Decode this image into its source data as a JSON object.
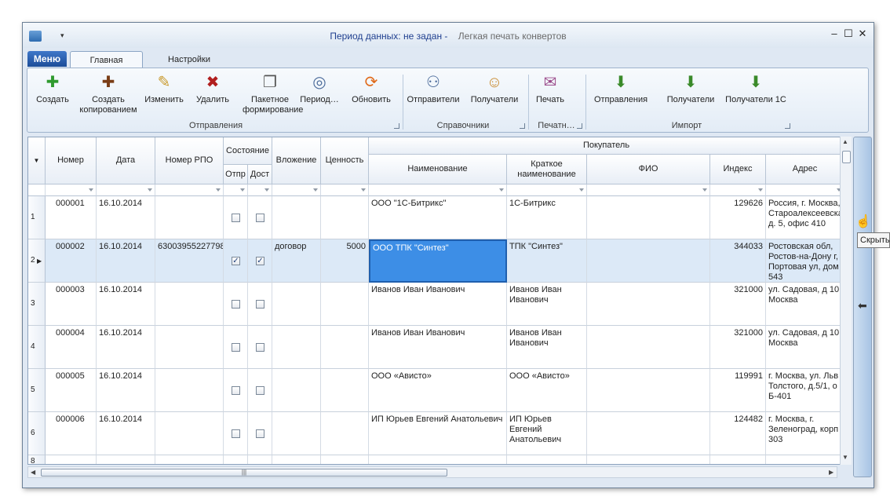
{
  "window": {
    "title_period": "Период данных: не задан -",
    "title_app": "Легкая печать конвертов",
    "minimize": "–",
    "maximize": "☐",
    "close": "✕",
    "qat_arrow": "▾"
  },
  "menu_button": "Меню",
  "tabs": [
    "Главная",
    "Настройки"
  ],
  "ribbon": {
    "groups": [
      {
        "label": "Отправления"
      },
      {
        "label": "Справочники"
      },
      {
        "label": "Печатн…"
      },
      {
        "label": "Импорт"
      }
    ],
    "buttons": [
      {
        "label": "Создать",
        "icon": "plus-green-icon",
        "glyph": "✚",
        "color": "#2f9a2f"
      },
      {
        "label": "Создать копированием",
        "icon": "plus-brown-icon",
        "glyph": "✚",
        "color": "#7a3d16"
      },
      {
        "label": "Изменить",
        "icon": "pencil-icon",
        "glyph": "✎",
        "color": "#c99a2e"
      },
      {
        "label": "Удалить",
        "icon": "delete-x-icon",
        "glyph": "✖",
        "color": "#b11f1f"
      },
      {
        "label": "Пакетное формирование",
        "icon": "pages-icon",
        "glyph": "❐",
        "color": "#555555"
      },
      {
        "label": "Период…",
        "icon": "calendar-globe-icon",
        "glyph": "◎",
        "color": "#4a6a9a"
      },
      {
        "label": "Обновить",
        "icon": "refresh-icon",
        "glyph": "⟳",
        "color": "#e06a1a"
      },
      {
        "label": "Отправители",
        "icon": "senders-icon",
        "glyph": "⚇",
        "color": "#4a6a9a"
      },
      {
        "label": "Получатели",
        "icon": "recipients-icon",
        "glyph": "☺",
        "color": "#c98a2e"
      },
      {
        "label": "Печать",
        "icon": "print-icon",
        "glyph": "✉",
        "color": "#9a4a8a"
      },
      {
        "label": "Отправления",
        "icon": "import-down-icon",
        "glyph": "⬇",
        "color": "#3a8a2a"
      },
      {
        "label": "Получатели",
        "icon": "import-down-icon",
        "glyph": "⬇",
        "color": "#3a8a2a"
      },
      {
        "label": "Получатели 1С",
        "icon": "import-down-icon",
        "glyph": "⬇",
        "color": "#3a8a2a"
      }
    ]
  },
  "grid": {
    "headers": {
      "number": "Номер",
      "date": "Дата",
      "rpo": "Номер РПО",
      "state": "Состояние",
      "sent": "Отпр",
      "delivered": "Дост",
      "attachment": "Вложение",
      "value": "Ценность",
      "buyer": "Покупатель",
      "name": "Наименование",
      "short_name": "Краткое наименование",
      "fio": "ФИО",
      "index": "Индекс",
      "address": "Адрес"
    },
    "rows": [
      {
        "n": "1",
        "number": "000001",
        "date": "16.10.2014",
        "rpo": "",
        "sent": false,
        "delivered": false,
        "attachment": "",
        "value": "",
        "name": "ООО \"1С-Битрикс\"",
        "short_name": "1С-Битрикс",
        "fio": "",
        "index": "129626",
        "address": "Россия, г. Москва,\nСтароалексеевска\nд. 5, офис 410"
      },
      {
        "n": "2",
        "number": "000002",
        "date": "16.10.2014",
        "rpo": "63003955227798",
        "sent": true,
        "delivered": true,
        "attachment": "договор",
        "value": "5000",
        "name": "ООО ТПК \"Синтез\"",
        "short_name": "ТПК \"Синтез\"",
        "fio": "",
        "index": "344033",
        "address": "Ростовская обл,\nРостов-на-Дону г,\nПортовая ул, дом\n543"
      },
      {
        "n": "3",
        "number": "000003",
        "date": "16.10.2014",
        "rpo": "",
        "sent": false,
        "delivered": false,
        "attachment": "",
        "value": "",
        "name": "Иванов Иван Иванович",
        "short_name": "Иванов Иван\nИванович",
        "fio": "",
        "index": "321000",
        "address": "ул. Садовая, д 10\nМосква"
      },
      {
        "n": "4",
        "number": "000004",
        "date": "16.10.2014",
        "rpo": "",
        "sent": false,
        "delivered": false,
        "attachment": "",
        "value": "",
        "name": "Иванов Иван Иванович",
        "short_name": "Иванов Иван\nИванович",
        "fio": "",
        "index": "321000",
        "address": "ул. Садовая, д 10\nМосква"
      },
      {
        "n": "5",
        "number": "000005",
        "date": "16.10.2014",
        "rpo": "",
        "sent": false,
        "delivered": false,
        "attachment": "",
        "value": "",
        "name": "ООО «Ависто»",
        "short_name": "ООО «Ависто»",
        "fio": "",
        "index": "119991",
        "address": "г. Москва, ул. Льв\nТолстого, д.5/1, о\nБ-401"
      },
      {
        "n": "6",
        "number": "000006",
        "date": "16.10.2014",
        "rpo": "",
        "sent": false,
        "delivered": false,
        "attachment": "",
        "value": "",
        "name": "ИП Юрьев Евгений Анатольевич",
        "short_name": "ИП Юрьев Евгений\nАнатольевич",
        "fio": "",
        "index": "124482",
        "address": "г. Москва, г.\nЗеленоград, корп\n303"
      }
    ],
    "new_row_number": "8",
    "current_row_marker": "▶",
    "selected_row": 1
  },
  "scroll": {
    "up": "▲",
    "down": "▼",
    "left": "◀",
    "right": "▶",
    "thumb_grip": "|||"
  },
  "side_panel": {
    "arrow": "⬅"
  },
  "tooltip": "Скрыть"
}
